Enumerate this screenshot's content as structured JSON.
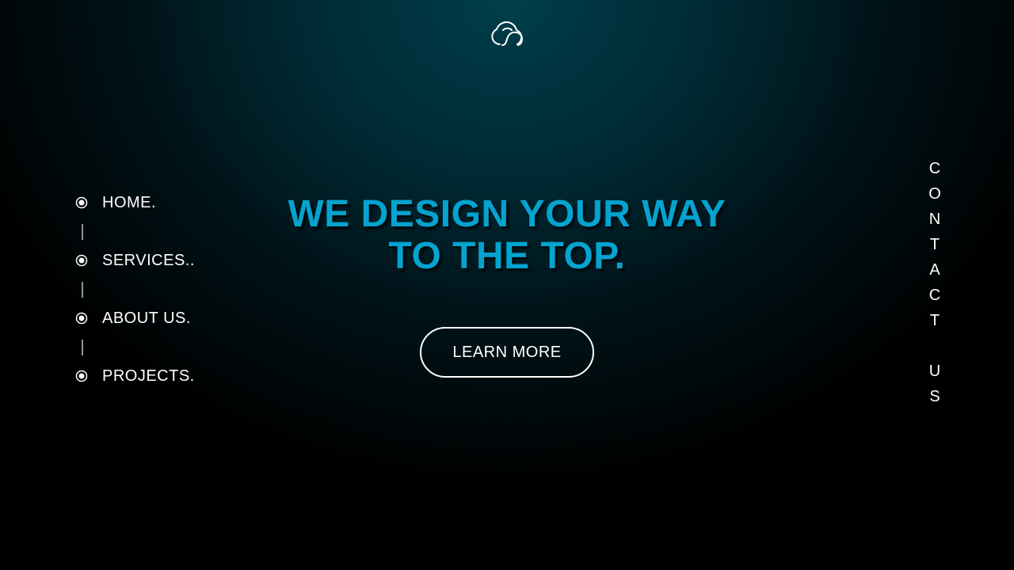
{
  "logo": {
    "icon": "cloud-logo-icon"
  },
  "nav": {
    "items": [
      {
        "label": "HOME.",
        "icon": "radio-dot-icon"
      },
      {
        "label": "SERVICES..",
        "icon": "radio-dot-icon"
      },
      {
        "label": "ABOUT US.",
        "icon": "radio-dot-icon"
      },
      {
        "label": "PROJECTS.",
        "icon": "radio-dot-icon"
      }
    ]
  },
  "hero": {
    "title_line1": "WE DESIGN YOUR WAY",
    "title_line2": "TO THE TOP.",
    "cta_label": "LEARN MORE"
  },
  "contact": {
    "word1": [
      "C",
      "O",
      "N",
      "T",
      "A",
      "C",
      "T"
    ],
    "word2": [
      "U",
      "S"
    ]
  },
  "colors": {
    "accent": "#05a3cf",
    "text": "#ffffff",
    "background_top": "#003e4b",
    "background_bottom": "#000000"
  }
}
